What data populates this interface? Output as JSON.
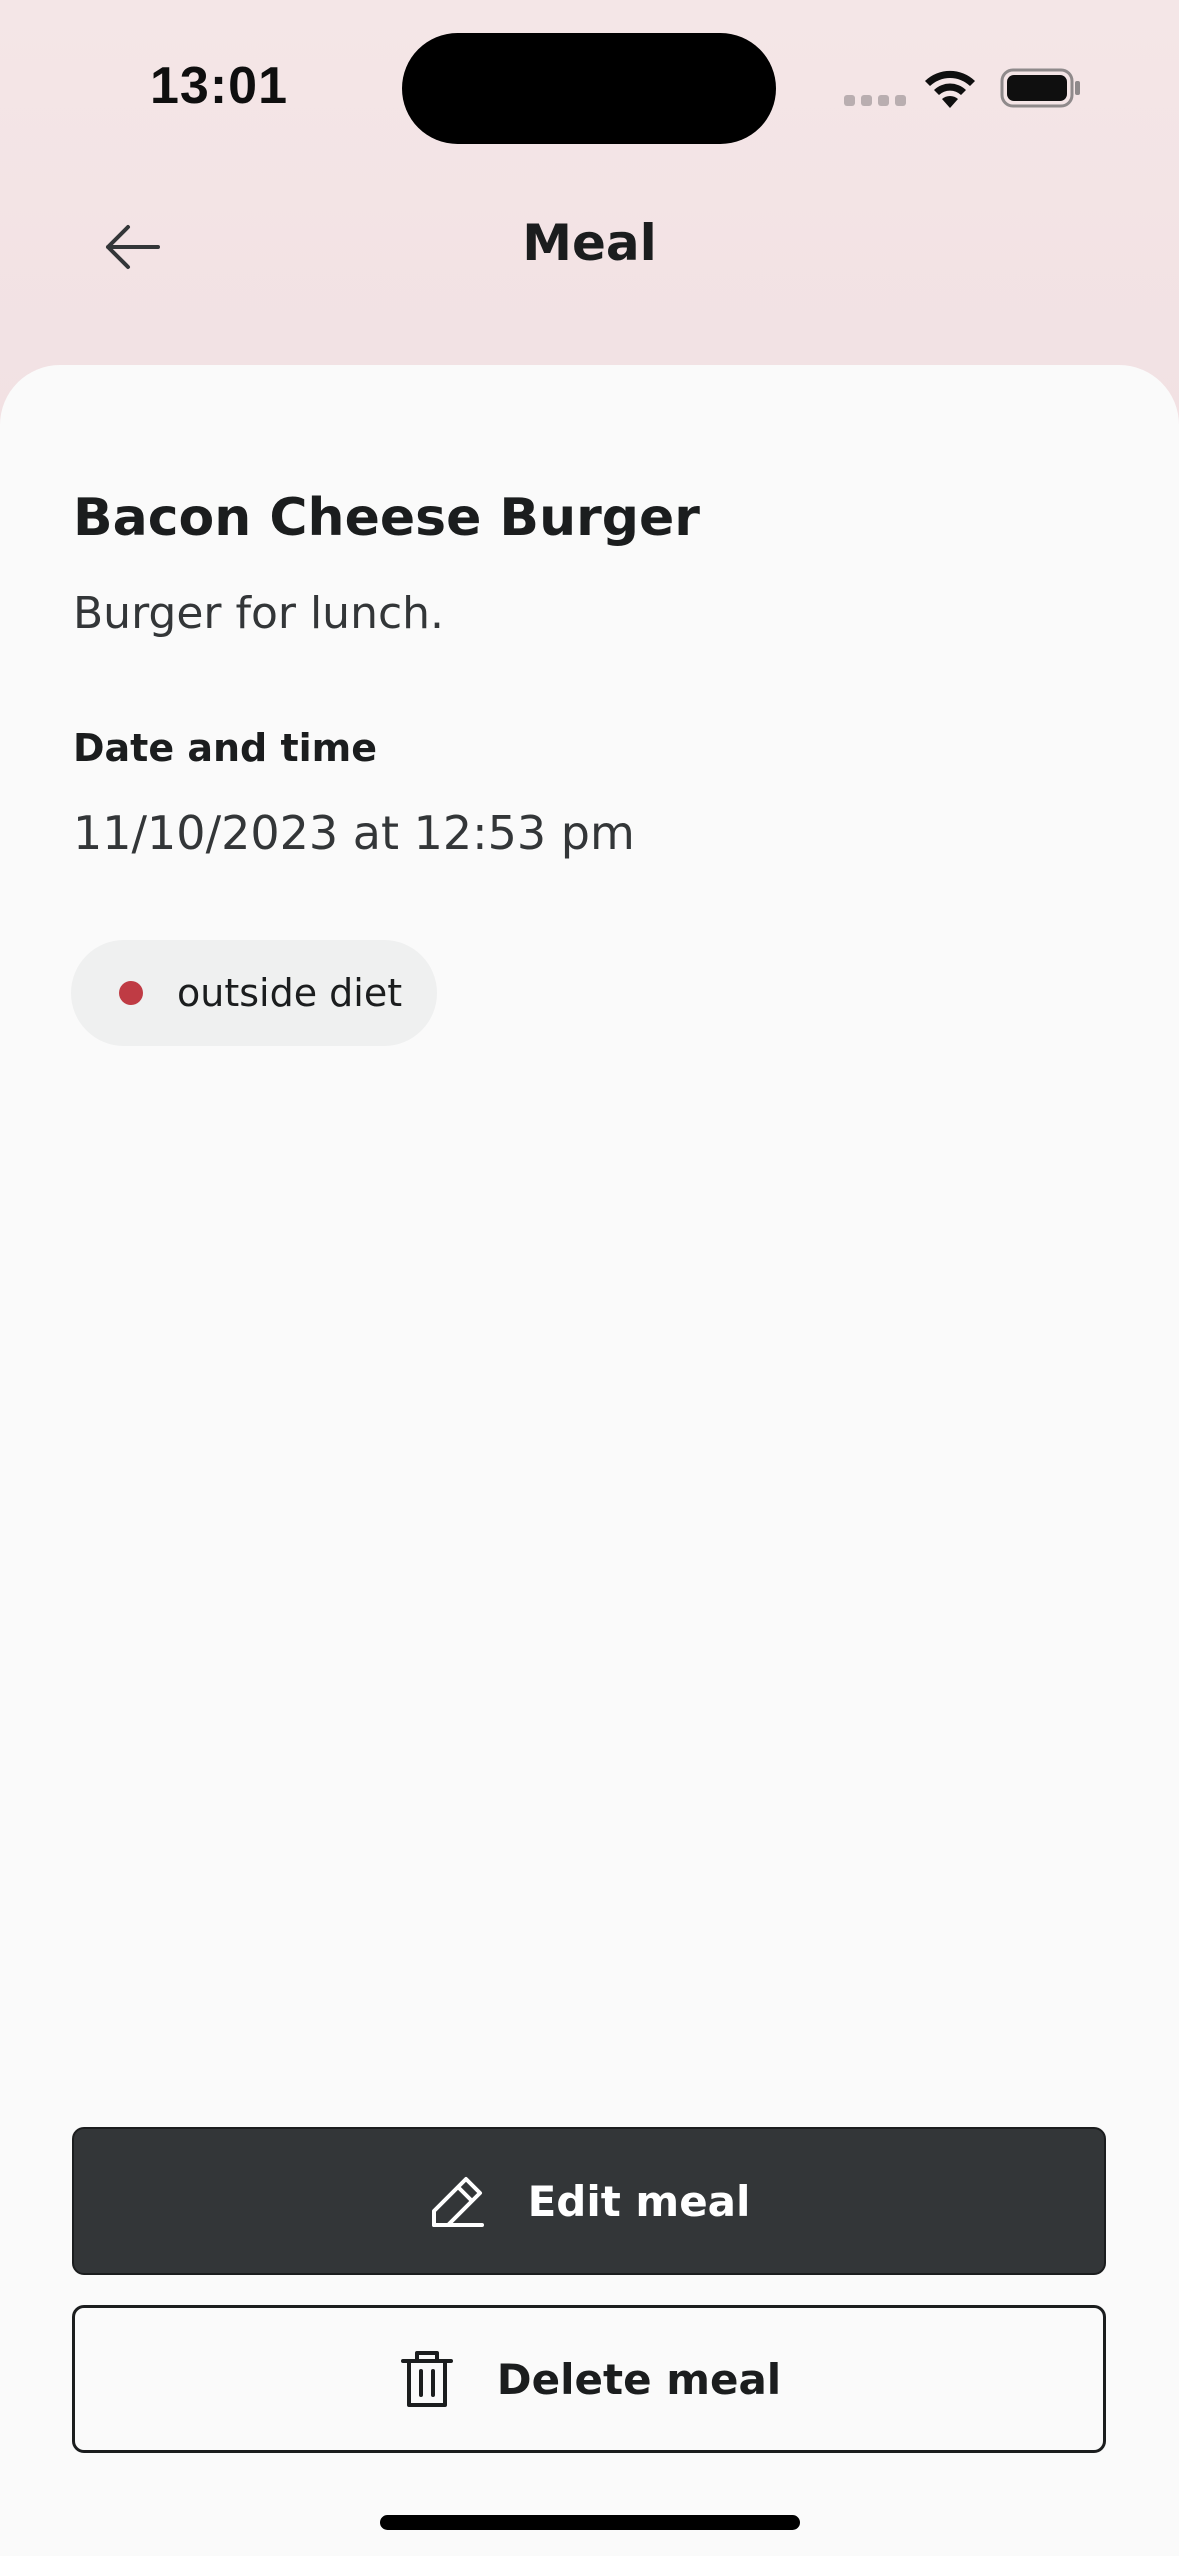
{
  "status_bar": {
    "time": "13:01"
  },
  "header": {
    "title": "Meal",
    "back_icon": "arrow-left-icon"
  },
  "meal": {
    "name": "Bacon Cheese Burger",
    "description": "Burger for lunch.",
    "date_time_label": "Date and time",
    "date_time_value": "11/10/2023 at 12:53 pm",
    "status_tag": {
      "label": "outside diet",
      "dot_color": "#BF3B44"
    }
  },
  "actions": {
    "edit": {
      "label": "Edit meal",
      "icon": "pencil-icon"
    },
    "delete": {
      "label": "Delete meal",
      "icon": "trash-icon"
    }
  },
  "colors": {
    "header_background": "#F4E4E6",
    "card_background": "#FAFAFA",
    "primary_button": "#333638",
    "text_primary": "#1B1D1E"
  }
}
